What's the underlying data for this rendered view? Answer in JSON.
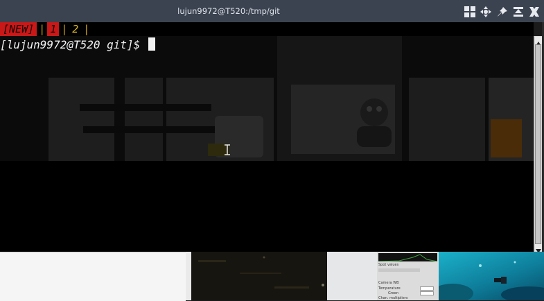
{
  "window": {
    "title": "lujun9972@T520:/tmp/git",
    "buttons": [
      "tile-icon",
      "move-icon",
      "pin-icon",
      "maximize-icon",
      "close-icon"
    ]
  },
  "terminal": {
    "tabs": {
      "new_label": "[NEW]",
      "separator": "|",
      "tab1": "1",
      "tab2": "2"
    },
    "prompt": "[lujun9972@T520 git]$ "
  },
  "desktop": {
    "app_labels": {
      "spot_values": "Spot values",
      "camera_wb": "Camera WB",
      "temperature": "Temperature",
      "green": "Green",
      "chan_multipliers": "Chan. multipliers"
    }
  },
  "colors": {
    "titlebar": "#3c4350",
    "terminal_bg": "#000000",
    "tab_active_bg": "#c81818",
    "tab_inactive_fg": "#d8b32a",
    "prompt_fg": "#f2f2f2"
  }
}
